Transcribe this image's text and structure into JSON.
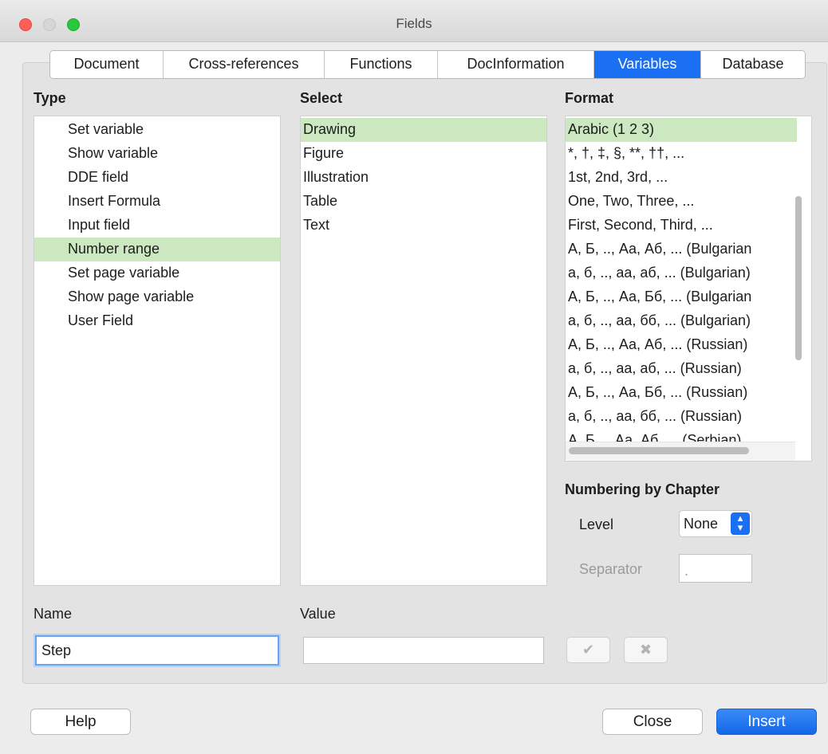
{
  "window": {
    "title": "Fields"
  },
  "tabs": [
    "Document",
    "Cross-references",
    "Functions",
    "DocInformation",
    "Variables",
    "Database"
  ],
  "active_tab": "Variables",
  "type": {
    "label": "Type",
    "items": [
      "Set variable",
      "Show variable",
      "DDE field",
      "Insert Formula",
      "Input field",
      "Number range",
      "Set page variable",
      "Show page variable",
      "User Field"
    ],
    "selected": "Number range"
  },
  "select": {
    "label": "Select",
    "items": [
      "Drawing",
      "Figure",
      "Illustration",
      "Table",
      "Text"
    ],
    "selected": "Drawing"
  },
  "format": {
    "label": "Format",
    "items": [
      "Arabic (1 2 3)",
      "*, †, ‡, §, **, ††, ...",
      "1st, 2nd, 3rd, ...",
      "One, Two, Three, ...",
      "First, Second, Third, ...",
      "А, Б, .., Аа, Аб, ... (Bulgarian",
      "а, б, .., аа, аб, ... (Bulgarian)",
      "А, Б, .., Аа, Бб, ... (Bulgarian",
      "а, б, .., аа, бб, ... (Bulgarian)",
      "А, Б, .., Аа, Аб, ... (Russian)",
      "а, б, .., аа, аб, ... (Russian)",
      "А, Б, .., Аа, Бб, ... (Russian)",
      "а, б, .., аа, бб, ... (Russian)",
      "А. Б. .. Аа. Аб. ... (Serbian)"
    ],
    "selected": "Arabic (1 2 3)"
  },
  "numbering": {
    "heading": "Numbering by Chapter",
    "level_label": "Level",
    "level_value": "None",
    "separator_label": "Separator",
    "separator_value": "."
  },
  "name": {
    "label": "Name",
    "value": "Step"
  },
  "value": {
    "label": "Value",
    "value": ""
  },
  "icons": {
    "apply": "checkmark-icon",
    "delete": "delete-x-icon"
  },
  "buttons": {
    "help": "Help",
    "close": "Close",
    "insert": "Insert"
  },
  "colors": {
    "accent": "#1a6ff2",
    "selection": "#cbe8c0"
  }
}
